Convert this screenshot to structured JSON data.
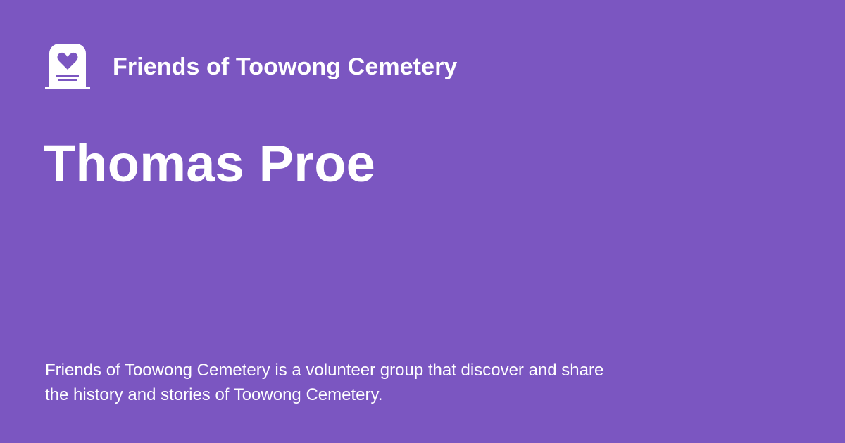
{
  "brand": {
    "name": "Friends of Toowong Cemetery",
    "icon": "headstone-heart-icon"
  },
  "page": {
    "title": "Thomas Proe",
    "description": "Friends of Toowong Cemetery is a volunteer group that discover and share the history and stories of Toowong Cemetery."
  },
  "colors": {
    "background": "#7b56c1",
    "text": "#ffffff"
  }
}
